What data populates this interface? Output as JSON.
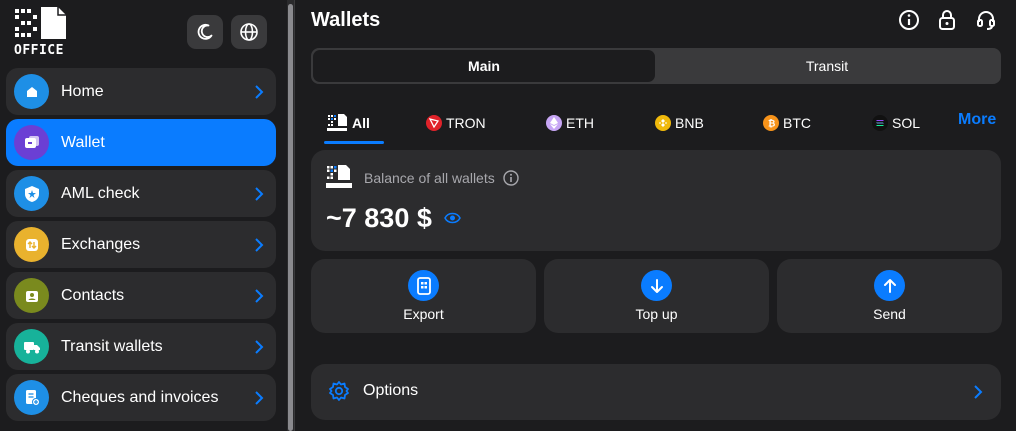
{
  "brand": {
    "logo_text": "OFFICE"
  },
  "sidebar": {
    "items": [
      {
        "label": "Home",
        "icon": "home-icon",
        "color": "#1e8fe6",
        "active": false
      },
      {
        "label": "Wallet",
        "icon": "wallet-icon",
        "color": "#6b3fd4",
        "active": true
      },
      {
        "label": "AML check",
        "icon": "shield-icon",
        "color": "#1e8fe6",
        "active": false
      },
      {
        "label": "Exchanges",
        "icon": "exchange-icon",
        "color": "#e9b22e",
        "active": false
      },
      {
        "label": "Contacts",
        "icon": "contacts-icon",
        "color": "#7a8a1e",
        "active": false
      },
      {
        "label": "Transit wallets",
        "icon": "truck-icon",
        "color": "#17b29a",
        "active": false
      },
      {
        "label": "Cheques and invoices",
        "icon": "invoice-icon",
        "color": "#1e8fe6",
        "active": false
      }
    ]
  },
  "header": {
    "title": "Wallets"
  },
  "segments": [
    {
      "label": "Main",
      "active": true
    },
    {
      "label": "Transit",
      "active": false
    }
  ],
  "currency_tabs": [
    {
      "label": "All",
      "icon": "office-logo-icon",
      "active": true
    },
    {
      "label": "TRON",
      "icon": "tron-icon",
      "color": "#e0222a"
    },
    {
      "label": "ETH",
      "icon": "eth-icon",
      "color": "#c7a6f5"
    },
    {
      "label": "BNB",
      "icon": "bnb-icon",
      "color": "#f0b90b"
    },
    {
      "label": "BTC",
      "icon": "btc-icon",
      "color": "#f7931a"
    },
    {
      "label": "SOL",
      "icon": "sol-icon",
      "color": "#111111"
    }
  ],
  "more_label": "More",
  "balance": {
    "label": "Balance of all wallets",
    "amount": "~7 830 $"
  },
  "actions": [
    {
      "label": "Export",
      "icon": "export-icon"
    },
    {
      "label": "Top up",
      "icon": "arrow-down-icon"
    },
    {
      "label": "Send",
      "icon": "arrow-up-icon"
    }
  ],
  "options": {
    "label": "Options"
  },
  "colors": {
    "accent": "#0a7cff",
    "card": "#2c2c2e",
    "background": "#1c1c1e"
  }
}
